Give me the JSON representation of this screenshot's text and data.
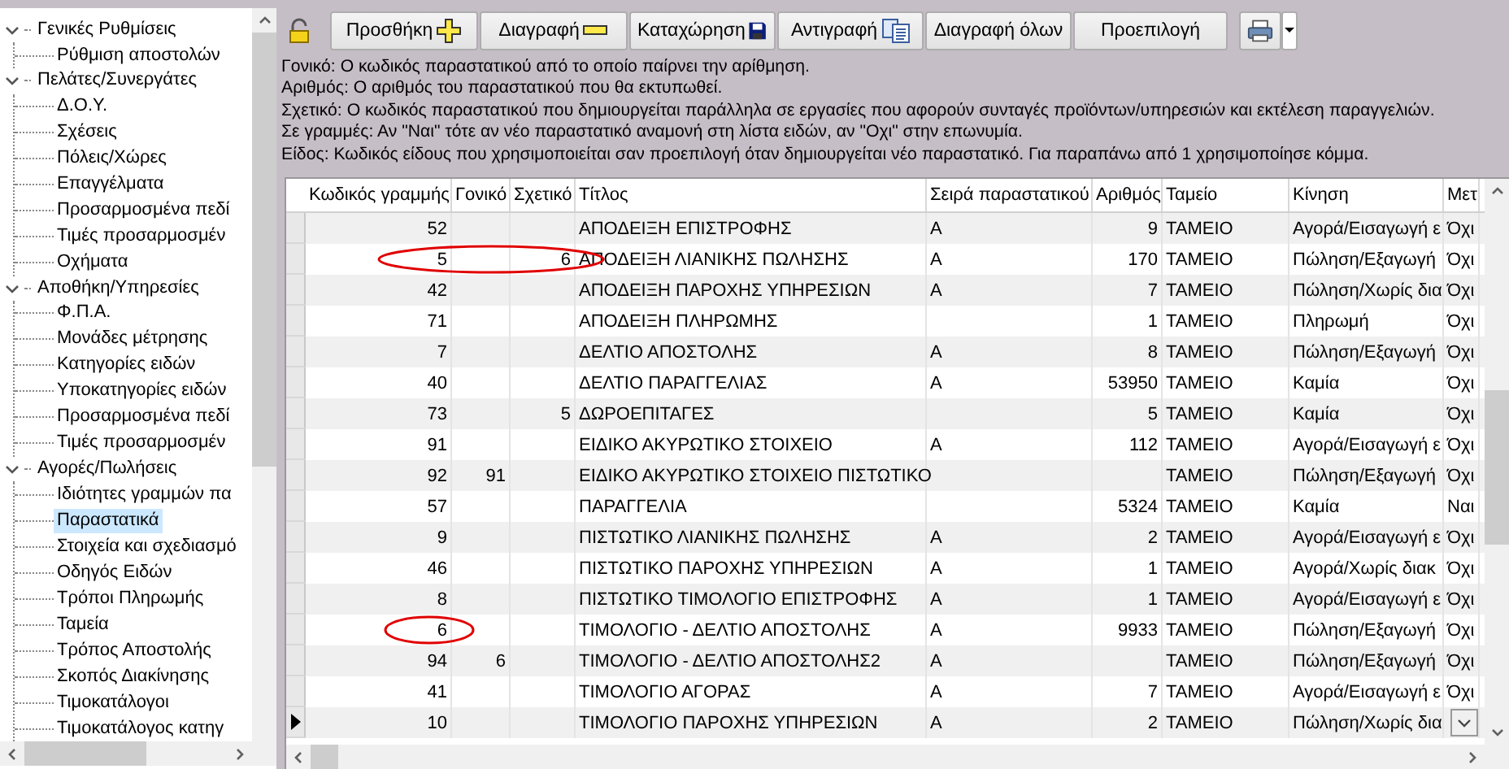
{
  "tree": [
    {
      "label": "Γενικές Ρυθμίσεις",
      "expanded": true,
      "selected": false,
      "children": [
        {
          "label": "Ρύθμιση αποστολών",
          "selected": false
        }
      ]
    },
    {
      "label": "Πελάτες/Συνεργάτες",
      "expanded": true,
      "selected": false,
      "children": [
        {
          "label": "Δ.Ο.Υ.",
          "selected": false
        },
        {
          "label": "Σχέσεις",
          "selected": false
        },
        {
          "label": "Πόλεις/Χώρες",
          "selected": false
        },
        {
          "label": "Επαγγέλματα",
          "selected": false
        },
        {
          "label": "Προσαρμοσμένα πεδί",
          "selected": false
        },
        {
          "label": "Τιμές προσαρμοσμέν",
          "selected": false
        },
        {
          "label": "Οχήματα",
          "selected": false
        }
      ]
    },
    {
      "label": "Αποθήκη/Υπηρεσίες",
      "expanded": true,
      "selected": false,
      "children": [
        {
          "label": "Φ.Π.Α.",
          "selected": false
        },
        {
          "label": "Μονάδες μέτρησης",
          "selected": false
        },
        {
          "label": "Κατηγορίες ειδών",
          "selected": false
        },
        {
          "label": "Υποκατηγορίες ειδών",
          "selected": false
        },
        {
          "label": "Προσαρμοσμένα πεδί",
          "selected": false
        },
        {
          "label": "Τιμές προσαρμοσμέν",
          "selected": false
        }
      ]
    },
    {
      "label": "Αγορές/Πωλήσεις",
      "expanded": true,
      "selected": false,
      "children": [
        {
          "label": "Ιδιότητες γραμμών πα",
          "selected": false
        },
        {
          "label": "Παραστατικά",
          "selected": true
        },
        {
          "label": "Στοιχεία και σχεδιασμό",
          "selected": false
        },
        {
          "label": "Οδηγός Ειδών",
          "selected": false
        },
        {
          "label": "Τρόποι Πληρωμής",
          "selected": false
        },
        {
          "label": "Ταμεία",
          "selected": false
        },
        {
          "label": "Τρόπος Αποστολής",
          "selected": false
        },
        {
          "label": "Σκοπός Διακίνησης",
          "selected": false
        },
        {
          "label": "Τιμοκατάλογοι",
          "selected": false
        },
        {
          "label": "Τιμοκατάλογος κατηγ",
          "selected": false
        }
      ]
    }
  ],
  "toolbar": {
    "buttons": [
      "Προσθήκη",
      "Διαγραφή",
      "Καταχώρηση",
      "Αντιγραφή",
      "Διαγραφή όλων",
      "Προεπιλογή"
    ]
  },
  "help": [
    "Γονικό: Ο κωδικός παραστατικού από το οποίο παίρνει την αρίθμηση.",
    "Αριθμός: Ο αριθμός του παραστατικού που θα εκτυπωθεί.",
    "Σχετικό: Ο κωδικός παραστατικού που δημιουργείται παράλληλα σε εργασίες που αφορούν συνταγές προϊόντων/υπηρεσιών και εκτέλεση παραγγελιών.",
    "Σε γραμμές: Αν \"Ναι\" τότε αν νέο παραστατικό αναμονή στη λίστα ειδών, αν \"Οχι\" στην επωνυμία.",
    "Είδος: Κωδικός είδους που χρησιμοποιείται σαν προεπιλογή όταν δημιουργείται νέο παραστατικό. Για παραπάνω από 1 χρησιμοποίησε κόμμα."
  ],
  "table": {
    "columns": [
      {
        "label": "Κωδικός γραμμής",
        "kind": "number"
      },
      {
        "label": "Γονικό",
        "kind": "number"
      },
      {
        "label": "Σχετικό",
        "kind": "number"
      },
      {
        "label": "Τίτλος",
        "kind": "text"
      },
      {
        "label": "Σειρά παραστατικού",
        "kind": "text"
      },
      {
        "label": "Αριθμός",
        "kind": "number"
      },
      {
        "label": "Ταμείο",
        "kind": "text"
      },
      {
        "label": "Κίνηση",
        "kind": "text"
      },
      {
        "label": "Μετ",
        "kind": "text"
      }
    ],
    "rows": [
      {
        "cells": [
          "52",
          null,
          null,
          "ΑΠΟΔΕΙΞΗ ΕΠΙΣΤΡΟΦΗΣ",
          "Α",
          "9",
          "ΤΑΜΕΙΟ",
          "Αγορά/Εισαγωγή ε",
          "Όχι"
        ],
        "current": false,
        "circled": false
      },
      {
        "cells": [
          "5",
          null,
          "6",
          "ΑΠΟΔΕΙΞΗ ΛΙΑΝΙΚΗΣ ΠΩΛΗΣΗΣ",
          "Α",
          "170",
          "ΤΑΜΕΙΟ",
          "Πώληση/Εξαγωγή",
          "Όχι"
        ],
        "current": false,
        "circled": true
      },
      {
        "cells": [
          "42",
          null,
          null,
          "ΑΠΟΔΕΙΞΗ ΠΑΡΟΧΗΣ ΥΠΗΡΕΣΙΩΝ",
          "Α",
          "7",
          "ΤΑΜΕΙΟ",
          "Πώληση/Χωρίς δια",
          "Όχι"
        ],
        "current": false,
        "circled": false
      },
      {
        "cells": [
          "71",
          null,
          null,
          "ΑΠΟΔΕΙΞΗ ΠΛΗΡΩΜΗΣ",
          null,
          "1",
          "ΤΑΜΕΙΟ",
          "Πληρωμή",
          "Όχι"
        ],
        "current": false,
        "circled": false
      },
      {
        "cells": [
          "7",
          null,
          null,
          "ΔΕΛΤΙΟ ΑΠΟΣΤΟΛΗΣ",
          "Α",
          "8",
          "ΤΑΜΕΙΟ",
          "Πώληση/Εξαγωγή",
          "Όχι"
        ],
        "current": false,
        "circled": false
      },
      {
        "cells": [
          "40",
          null,
          null,
          "ΔΕΛΤΙΟ ΠΑΡΑΓΓΕΛΙΑΣ",
          "Α",
          "53950",
          "ΤΑΜΕΙΟ",
          "Καμία",
          "Όχι"
        ],
        "current": false,
        "circled": false
      },
      {
        "cells": [
          "73",
          null,
          "5",
          "ΔΩΡΟΕΠΙΤΑΓΕΣ",
          null,
          "5",
          "ΤΑΜΕΙΟ",
          "Καμία",
          "Όχι"
        ],
        "current": false,
        "circled": false
      },
      {
        "cells": [
          "91",
          null,
          null,
          "ΕΙΔΙΚΟ ΑΚΥΡΩΤΙΚΟ ΣΤΟΙΧΕΙΟ",
          "Α",
          "112",
          "ΤΑΜΕΙΟ",
          "Αγορά/Εισαγωγή ε",
          "Όχι"
        ],
        "current": false,
        "circled": false
      },
      {
        "cells": [
          "92",
          "91",
          null,
          "ΕΙΔΙΚΟ ΑΚΥΡΩΤΙΚΟ ΣΤΟΙΧΕΙΟ ΠΙΣΤΩΤΙΚΟ",
          null,
          null,
          "ΤΑΜΕΙΟ",
          "Πώληση/Εξαγωγή",
          "Όχι"
        ],
        "current": false,
        "circled": false
      },
      {
        "cells": [
          "57",
          null,
          null,
          "ΠΑΡΑΓΓΕΛΙΑ",
          null,
          "5324",
          "ΤΑΜΕΙΟ",
          "Καμία",
          "Ναι"
        ],
        "current": false,
        "circled": false
      },
      {
        "cells": [
          "9",
          null,
          null,
          "ΠΙΣΤΩΤΙΚΟ ΛΙΑΝΙΚΗΣ ΠΩΛΗΣΗΣ",
          "Α",
          "2",
          "ΤΑΜΕΙΟ",
          "Αγορά/Εισαγωγή ε",
          "Όχι"
        ],
        "current": false,
        "circled": false
      },
      {
        "cells": [
          "46",
          null,
          null,
          "ΠΙΣΤΩΤΙΚΟ ΠΑΡΟΧΗΣ ΥΠΗΡΕΣΙΩΝ",
          "Α",
          "1",
          "ΤΑΜΕΙΟ",
          "Αγορά/Χωρίς διακ",
          "Όχι"
        ],
        "current": false,
        "circled": false
      },
      {
        "cells": [
          "8",
          null,
          null,
          "ΠΙΣΤΩΤΙΚΟ ΤΙΜΟΛΟΓΙΟ ΕΠΙΣΤΡΟΦΗΣ",
          "Α",
          "1",
          "ΤΑΜΕΙΟ",
          "Αγορά/Εισαγωγή ε",
          "Όχι"
        ],
        "current": false,
        "circled": false
      },
      {
        "cells": [
          "6",
          null,
          null,
          "ΤΙΜΟΛΟΓΙΟ - ΔΕΛΤΙΟ ΑΠΟΣΤΟΛΗΣ",
          "Α",
          "9933",
          "ΤΑΜΕΙΟ",
          "Πώληση/Εξαγωγή",
          "Όχι"
        ],
        "current": false,
        "circled": true
      },
      {
        "cells": [
          "94",
          "6",
          null,
          "ΤΙΜΟΛΟΓΙΟ - ΔΕΛΤΙΟ ΑΠΟΣΤΟΛΗΣ2",
          "Α",
          null,
          "ΤΑΜΕΙΟ",
          "Πώληση/Εξαγωγή",
          "Όχι"
        ],
        "current": false,
        "circled": false
      },
      {
        "cells": [
          "41",
          null,
          null,
          "ΤΙΜΟΛΟΓΙΟ ΑΓΟΡΑΣ",
          "Α",
          "7",
          "ΤΑΜΕΙΟ",
          "Αγορά/Εισαγωγή ε",
          "Όχι"
        ],
        "current": false,
        "circled": false
      },
      {
        "cells": [
          "10",
          null,
          null,
          "ΤΙΜΟΛΟΓΙΟ ΠΑΡΟΧΗΣ ΥΠΗΡΕΣΙΩΝ",
          "Α",
          "2",
          "ΤΑΜΕΙΟ",
          "Πώληση/Χωρίς δια",
          null
        ],
        "current": true,
        "circled": false
      }
    ]
  }
}
